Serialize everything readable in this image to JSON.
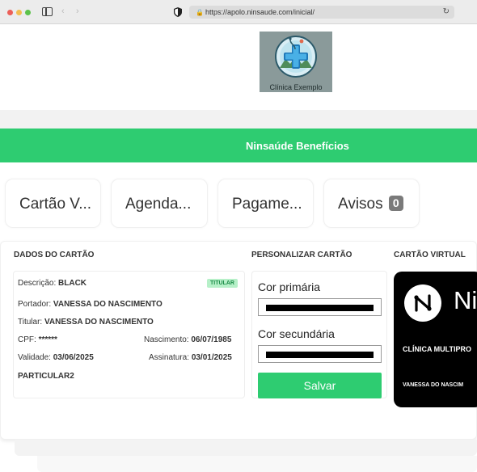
{
  "browser": {
    "url": "https://apolo.ninsaude.com/inicial/",
    "icons": [
      "sidebar-icon",
      "back-icon",
      "forward-icon",
      "shield-icon",
      "lock-icon",
      "reload-icon"
    ]
  },
  "header": {
    "logo_text": "Clínica Exemplo",
    "banner_title": "Ninsaúde Benefícios"
  },
  "tabs": [
    {
      "label": "Cartão V..."
    },
    {
      "label": "Agenda..."
    },
    {
      "label": "Pagame..."
    },
    {
      "label": "Avisos",
      "badge": "0"
    }
  ],
  "dados_cartao": {
    "title": "DADOS DO CARTÃO",
    "descricao_label": "Descrição:",
    "descricao_value": "BLACK",
    "tag": "TITULAR",
    "portador_label": "Portador:",
    "portador_value": "VANESSA DO NASCIMENTO",
    "titular_label": "Titular:",
    "titular_value": "VANESSA DO NASCIMENTO",
    "cpf_label": "CPF:",
    "cpf_value": "******",
    "nascimento_label": "Nascimento:",
    "nascimento_value": "06/07/1985",
    "validade_label": "Validade:",
    "validade_value": "03/06/2025",
    "assinatura_label": "Assinatura:",
    "assinatura_value": "03/01/2025",
    "plano": "PARTICULAR2"
  },
  "personalizar": {
    "title": "PERSONALIZAR CARTÃO",
    "primary_label": "Cor primária",
    "primary_value": "#000000",
    "secondary_label": "Cor secundária",
    "secondary_value": "#000000",
    "save_label": "Salvar"
  },
  "cartao_virtual": {
    "title": "CARTÃO VIRTUAL",
    "brand": "Ni",
    "clinic": "CLÍNICA MULTIPRO",
    "name": "VANESSA DO NASCIM"
  },
  "colors": {
    "accent": "#2ecc71",
    "card_bg": "#000000",
    "tag_bg": "#b6f0c8"
  }
}
